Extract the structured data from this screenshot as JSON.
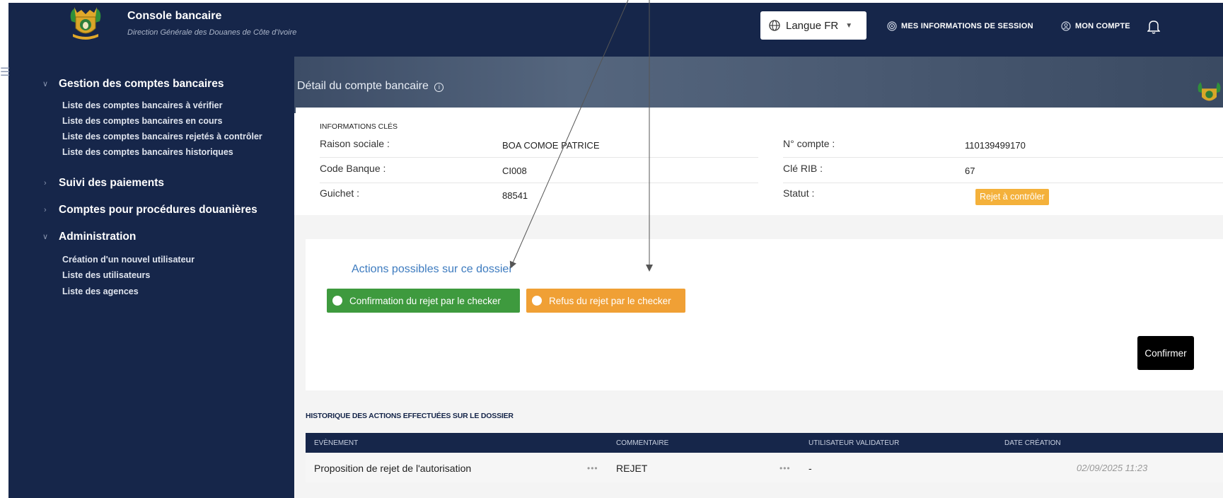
{
  "header": {
    "title": "Console bancaire",
    "subtitle": "Direction Générale des Douanes de Côte d'Ivoire",
    "language_label": "Langue FR",
    "session_label": "MES INFORMATIONS DE SESSION",
    "account_label": "MON COMPTE"
  },
  "sidebar": {
    "groups": [
      {
        "label": "Gestion des comptes bancaires",
        "items": [
          "Liste des comptes bancaires à vérifier",
          "Liste des comptes bancaires en cours",
          "Liste des comptes bancaires rejetés à contrôler",
          "Liste des comptes bancaires historiques"
        ]
      },
      {
        "label": "Suivi des paiements",
        "items": []
      },
      {
        "label": "Comptes pour procédures douanières",
        "items": []
      },
      {
        "label": "Administration",
        "items": [
          "Création d'un nouvel utilisateur",
          "Liste des utilisateurs",
          "Liste des agences"
        ]
      }
    ]
  },
  "page": {
    "title": "Détail du compte bancaire"
  },
  "info": {
    "section_title": "INFORMATIONS CLÉS",
    "raison_sociale_label": "Raison sociale :",
    "raison_sociale_value": "BOA COMOE PATRICE",
    "code_banque_label": "Code Banque :",
    "code_banque_value": "CI008",
    "guichet_label": "Guichet :",
    "guichet_value": "88541",
    "compte_label": "N° compte :",
    "compte_value": "110139499170",
    "cle_rib_label": "Clé RIB :",
    "cle_rib_value": "67",
    "statut_label": "Statut :",
    "statut_value": "Rejet à contrôler"
  },
  "actions": {
    "title": "Actions possibles sur ce dossier",
    "option_confirm": "Confirmation du rejet par le checker",
    "option_refuse": "Refus du rejet par le checker",
    "confirm_button": "Confirmer"
  },
  "history": {
    "title": "HISTORIQUE DES ACTIONS EFFECTUÉES SUR LE DOSSIER",
    "columns": [
      "EVÈNEMENT",
      "COMMENTAIRE",
      "UTILISATEUR VALIDATEUR",
      "DATE CRÉATION"
    ],
    "rows": [
      {
        "event": "Proposition de rejet de l'autorisation",
        "comment": "REJET",
        "user": "-",
        "date": "02/09/2025 11:23"
      }
    ]
  },
  "colors": {
    "navy": "#16264a",
    "green": "#3e9a3e",
    "orange": "#f0a035",
    "status_orange": "#f4b13b",
    "link_blue": "#3d7bbf"
  }
}
